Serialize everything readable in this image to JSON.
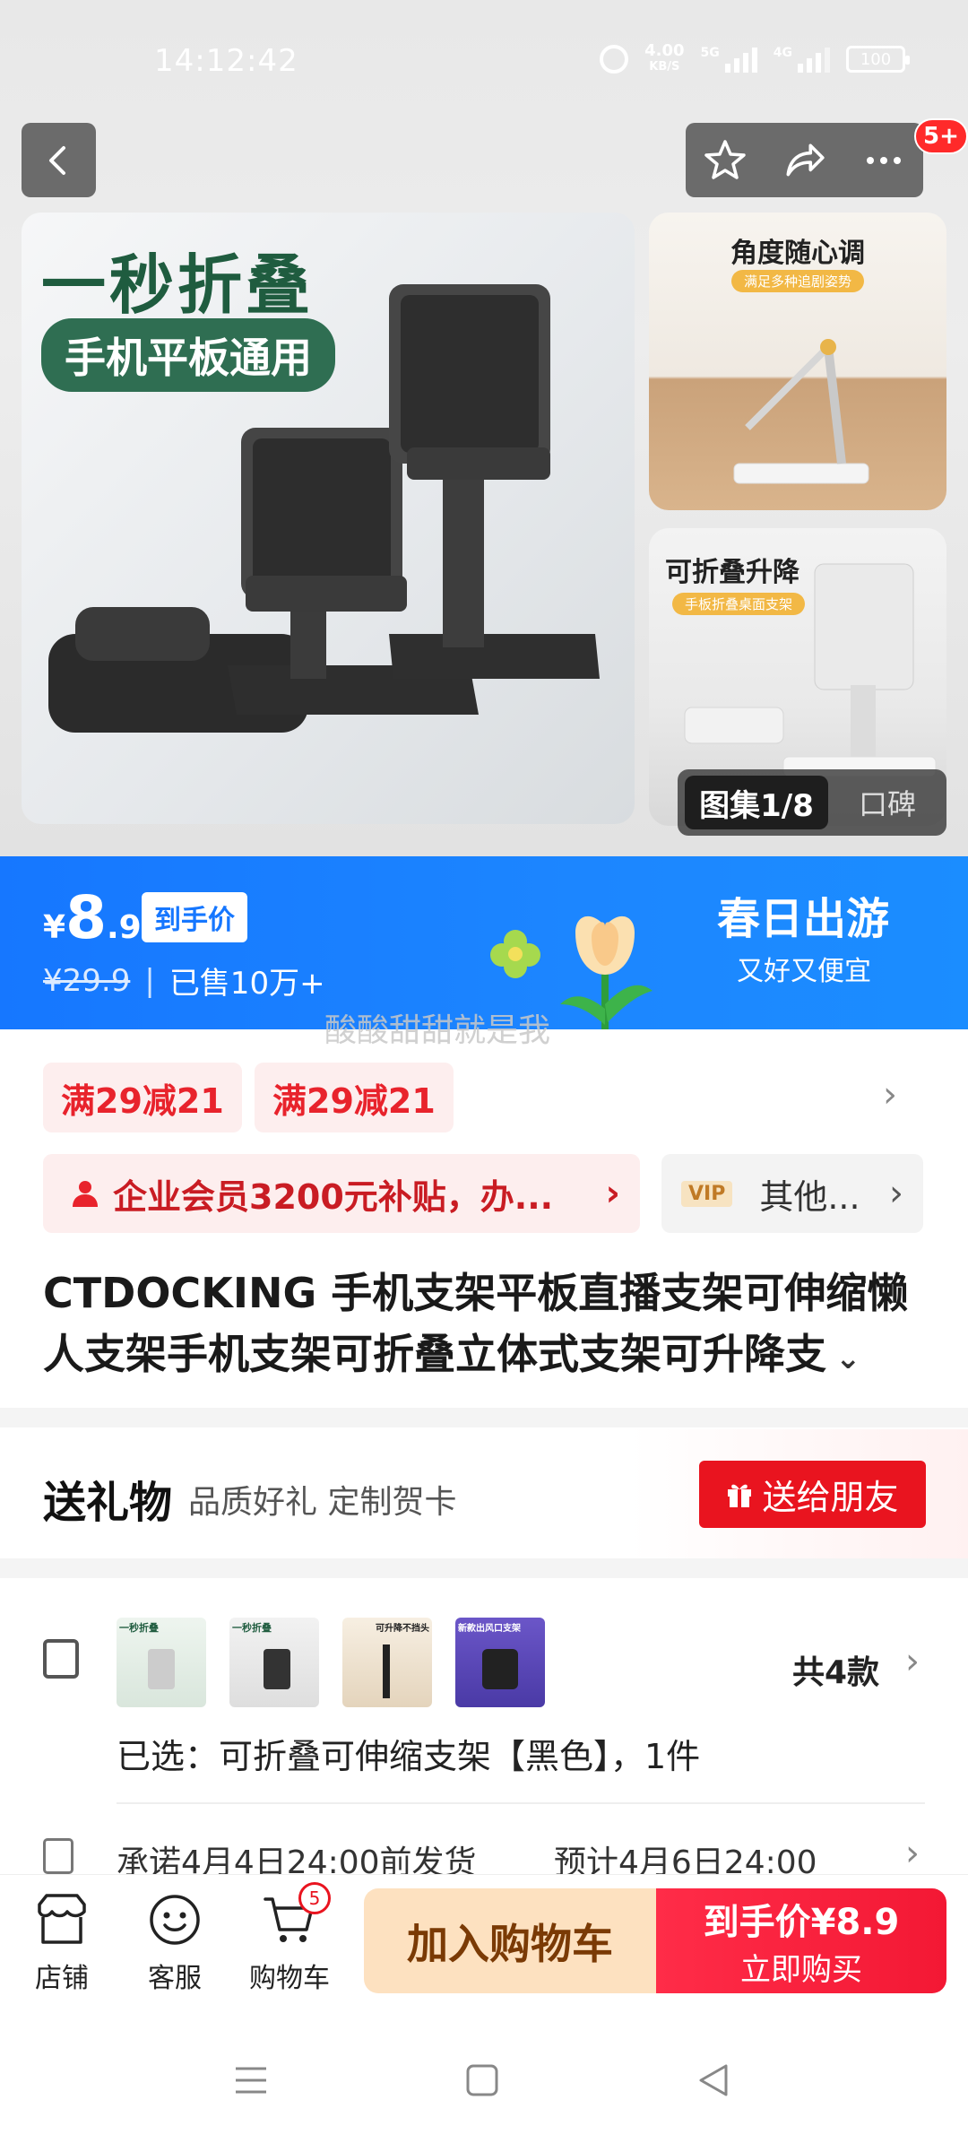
{
  "status_bar": {
    "time": "14:12:42",
    "net_speed_value": "4.00",
    "net_speed_unit": "KB/S",
    "sig1_tag": "5G",
    "sig2_tag": "4G",
    "battery": "100"
  },
  "header": {
    "notification_badge": "5+"
  },
  "gallery": {
    "main_headline": "一秒折叠",
    "main_pill": "手机平板通用",
    "side1_title": "角度随心调",
    "side1_sub": "满足多种追剧姿势",
    "side2_title": "可折叠升降",
    "side2_sub": "手板折叠桌面支架",
    "counter_current": "图集1/8",
    "counter_alt": "口碑"
  },
  "price": {
    "currency": "¥",
    "integer": "8",
    "decimal": ".9",
    "tag": "到手价",
    "original": "¥29.9",
    "separator": "|",
    "sold": "已售10万+",
    "promo_title": "春日出游",
    "promo_sub": "又好又便宜"
  },
  "watermark": "酸酸甜甜就是我",
  "coupons": [
    "满29减21",
    "满29减21"
  ],
  "member": {
    "text": "企业会员3200元补贴，办...",
    "vip_tag": "VIP",
    "vip_text": "其他..."
  },
  "product": {
    "title": "CTDOCKING 手机支架平板直播支架可伸缩懒人支架手机支架可折叠立体式支架可升降支"
  },
  "gift": {
    "title": "送礼物",
    "subtitle": "品质好礼 定制贺卡",
    "button": "送给朋友"
  },
  "sku": {
    "thumb_labels": [
      "一秒折叠",
      "一秒折叠",
      "可升降不挡头",
      "新款出风口支架"
    ],
    "count": "共4款",
    "selected": "已选：可折叠可伸缩支架【黑色】，1件",
    "shipping_left": "承诺4月4日24:00前发货",
    "shipping_right": "预计4月6日24:00"
  },
  "bottom_bar": {
    "store": "店铺",
    "service": "客服",
    "cart": "购物车",
    "cart_count": "5",
    "add_to_cart": "加入购物车",
    "buy_price_line": "到手价¥8.9",
    "buy_now": "立即购买"
  },
  "colors": {
    "brand_blue": "#1677ff",
    "accent_red": "#e9141f",
    "cart_bg": "#fde1c0"
  }
}
